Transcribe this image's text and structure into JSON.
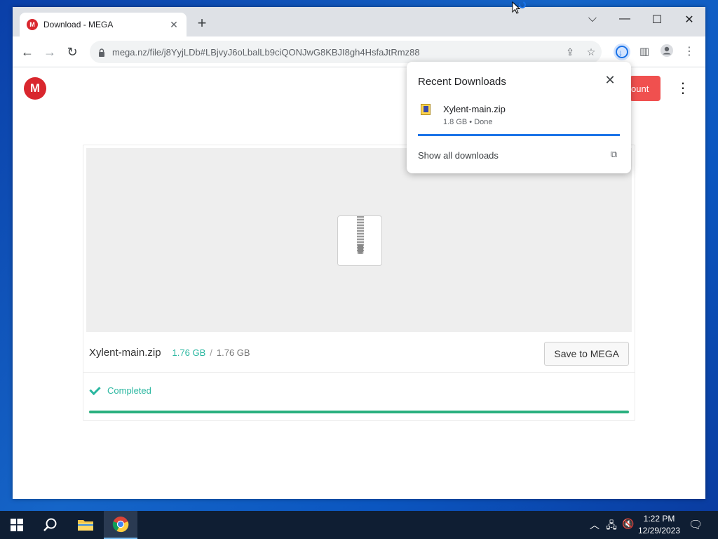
{
  "browser": {
    "tab_title": "Download - MEGA",
    "favicon_letter": "M",
    "url": "mega.nz/file/j8YyjLDb#LBjvyJ6oLbalLb9ciQONJwG8KBJI8gh4HsfaJtRmz88",
    "window_controls": {
      "dropdown": "⌵",
      "minimize": "—",
      "maximize": "☐",
      "close": "✕"
    }
  },
  "page": {
    "logo_letter": "M",
    "create_button_label": "ount",
    "file": {
      "name": "Xylent-main.zip",
      "downloaded": "1.76 GB",
      "separator": "/",
      "total": "1.76 GB"
    },
    "save_button_label": "Save to MEGA",
    "status": "Completed",
    "progress_fraction": 1.0,
    "accent_color": "#2ab7a0"
  },
  "downloads_bubble": {
    "title": "Recent Downloads",
    "items": [
      {
        "name": "Xylent-main.zip",
        "meta": "1.8 GB • Done",
        "progress_fraction": 1.0
      }
    ],
    "show_all_label": "Show all downloads"
  },
  "taskbar": {
    "time": "1:22 PM",
    "date": "12/29/2023"
  }
}
